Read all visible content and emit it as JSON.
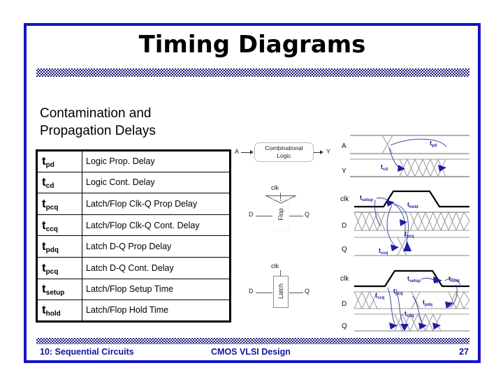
{
  "slide": {
    "title": "Timing Diagrams",
    "heading": "Contamination and Propagation Delays",
    "heading_line1": "Contamination and",
    "heading_line2": "Propagation Delays",
    "border_color": "#1414c8",
    "accent_color": "#1a1a7a",
    "annotation_color": "#1c1ca0"
  },
  "table": {
    "rows": [
      {
        "base": "t",
        "sub": "pd",
        "desc": "Logic Prop. Delay"
      },
      {
        "base": "t",
        "sub": "cd",
        "desc": "Logic Cont. Delay"
      },
      {
        "base": "t",
        "sub": "pcq",
        "desc": "Latch/Flop Clk-Q Prop Delay"
      },
      {
        "base": "t",
        "sub": "ccq",
        "desc": "Latch/Flop Clk-Q Cont. Delay"
      },
      {
        "base": "t",
        "sub": "pdq",
        "desc": "Latch D-Q Prop Delay"
      },
      {
        "base": "t",
        "sub": "pcq",
        "desc": "Latch D-Q Cont. Delay"
      },
      {
        "base": "t",
        "sub": "setup",
        "desc": "Latch/Flop Setup Time"
      },
      {
        "base": "t",
        "sub": "hold",
        "desc": "Latch/Flop Hold Time"
      }
    ]
  },
  "circuits": {
    "combinational": {
      "block_line1": "Combinational",
      "block_line2": "Logic",
      "input": "A",
      "output": "Y"
    },
    "flop": {
      "name": "Flop",
      "clk": "clk",
      "input": "D",
      "output": "Q"
    },
    "latch": {
      "name": "Latch",
      "clk": "clk",
      "input": "D",
      "output": "Q"
    }
  },
  "waveforms": [
    {
      "id": "logic",
      "signals": [
        "A",
        "Y"
      ],
      "annotations": [
        {
          "base": "t",
          "sub": "pd"
        },
        {
          "base": "t",
          "sub": "cd"
        }
      ]
    },
    {
      "id": "flop",
      "signals": [
        "clk",
        "D",
        "Q"
      ],
      "annotations": [
        {
          "base": "t",
          "sub": "setup"
        },
        {
          "base": "t",
          "sub": "hold"
        },
        {
          "base": "t",
          "sub": "pcq"
        },
        {
          "base": "t",
          "sub": "ccq"
        }
      ]
    },
    {
      "id": "latch",
      "signals": [
        "clk",
        "D",
        "Q"
      ],
      "annotations": [
        {
          "base": "t",
          "sub": "ccq"
        },
        {
          "base": "t",
          "sub": "pcq"
        },
        {
          "base": "t",
          "sub": "setup"
        },
        {
          "base": "t",
          "sub": "hold"
        },
        {
          "base": "t",
          "sub": "cdq"
        },
        {
          "base": "t",
          "sub": "pdq"
        }
      ]
    }
  ],
  "footer": {
    "left": "10: Sequential Circuits",
    "middle": "CMOS VLSI Design",
    "page": "27"
  }
}
